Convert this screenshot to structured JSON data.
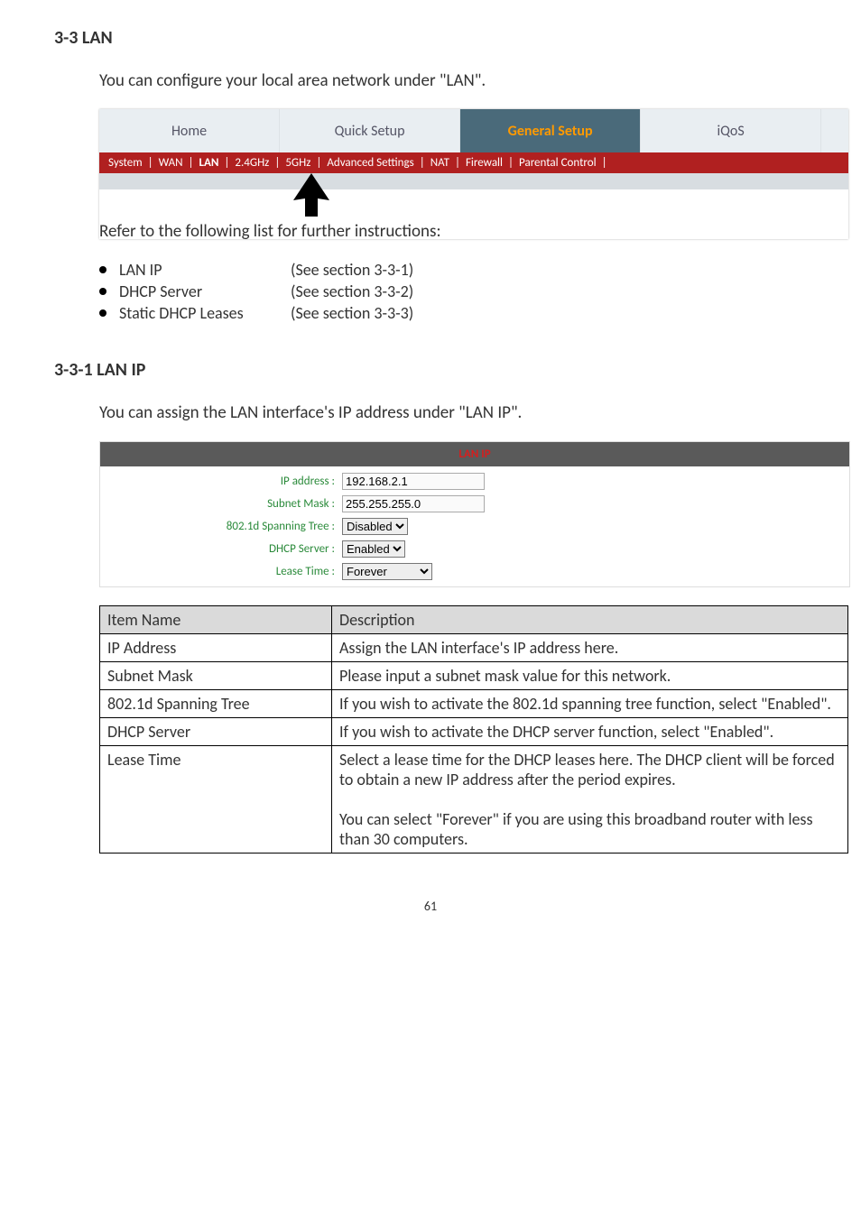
{
  "section_heading": "3-3 LAN",
  "intro_text": "You can configure your local area network under \"LAN\".",
  "nav": {
    "tabs": [
      "Home",
      "Quick Setup",
      "General Setup",
      "iQoS"
    ],
    "subitems": [
      "System",
      "WAN",
      "LAN",
      "2.4GHz",
      "5GHz",
      "Advanced Settings",
      "NAT",
      "Firewall",
      "Parental Control"
    ]
  },
  "refer_text": "Refer to the following list for further instructions:",
  "bullets": [
    {
      "label": "LAN IP",
      "ref": "(See section 3-3-1)"
    },
    {
      "label": "DHCP Server",
      "ref": "(See section 3-3-2)"
    },
    {
      "label": "Static DHCP Leases",
      "ref": "(See section 3-3-3)"
    }
  ],
  "subsection_heading": "3-3-1 LAN IP",
  "subsection_intro": "You can assign the LAN interface's IP address under \"LAN IP\".",
  "lanip_panel": {
    "title": "LAN IP",
    "rows": {
      "ip_label": "IP address :",
      "ip_value": "192.168.2.1",
      "mask_label": "Subnet Mask :",
      "mask_value": "255.255.255.0",
      "spanning_label": "802.1d Spanning Tree :",
      "spanning_value": "Disabled",
      "dhcp_label": "DHCP Server :",
      "dhcp_value": "Enabled",
      "lease_label": "Lease Time :",
      "lease_value": "Forever"
    }
  },
  "desc_table": {
    "headers": [
      "Item Name",
      "Description"
    ],
    "rows": [
      [
        "IP Address",
        "Assign the LAN interface's IP address here."
      ],
      [
        "Subnet Mask",
        "Please input a subnet mask value for this network."
      ],
      [
        "802.1d Spanning Tree",
        "If you wish to activate the 802.1d spanning tree function, select \"Enabled\"."
      ],
      [
        "DHCP Server",
        "If you wish to activate the DHCP server function, select \"Enabled\"."
      ],
      [
        "Lease Time",
        "Select a lease time for the DHCP leases here. The DHCP client will be forced to obtain a new IP address after the period expires.\n\nYou can select \"Forever\" if you are using this broadband router with less than 30 computers."
      ]
    ]
  },
  "page_number": "61"
}
